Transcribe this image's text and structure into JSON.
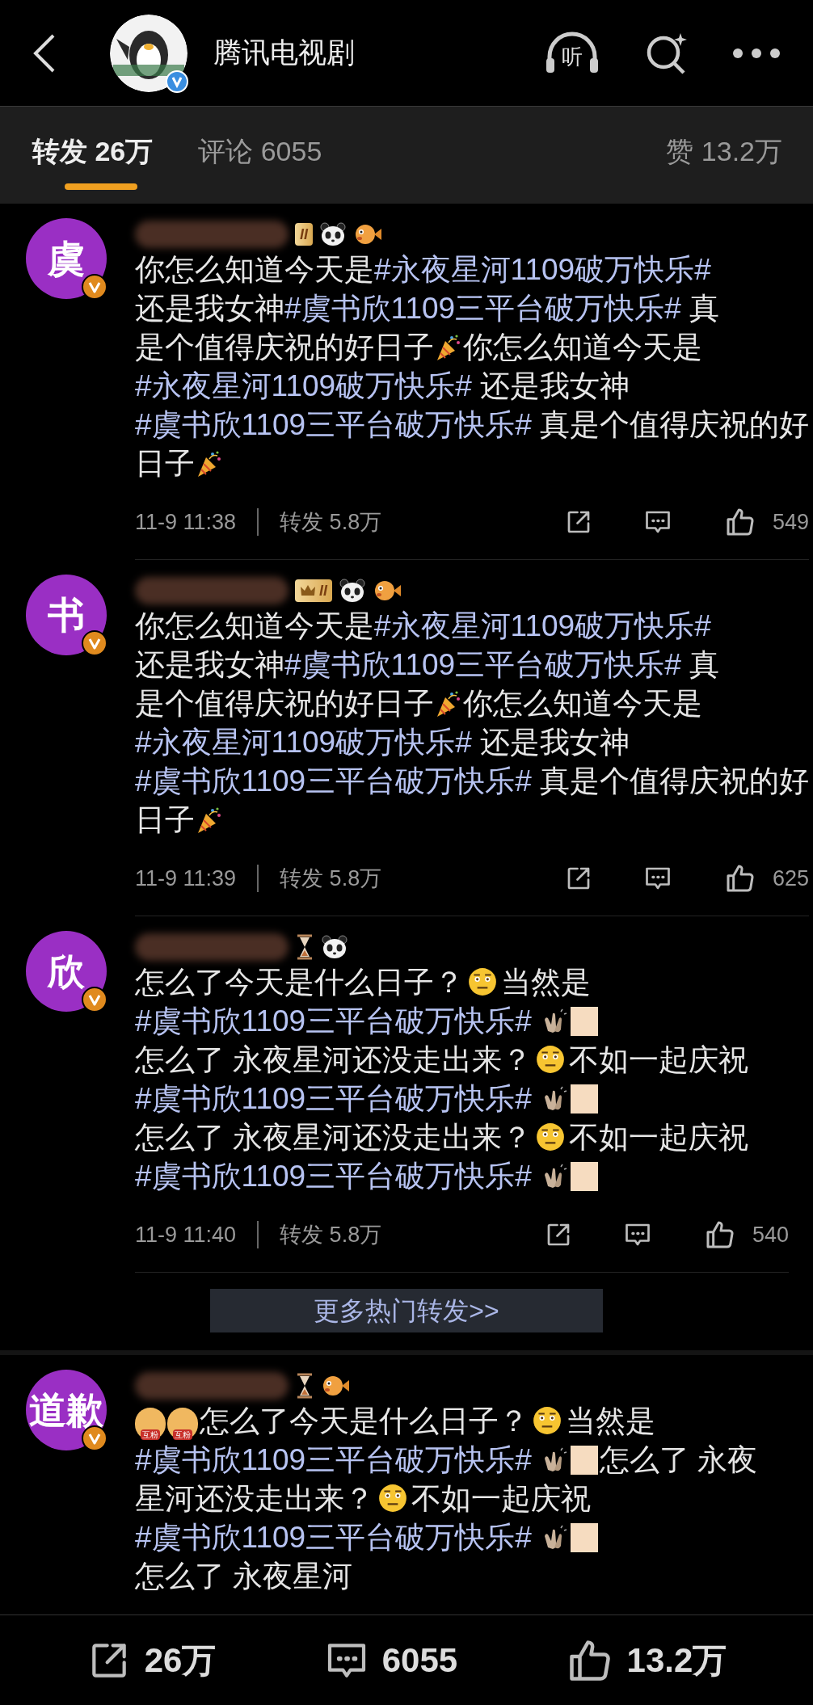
{
  "header": {
    "title": "腾讯电视剧",
    "listen_label": "听"
  },
  "tabs": [
    {
      "label": "转发 26万",
      "selected": true
    },
    {
      "label": "评论 6055",
      "selected": false
    },
    {
      "label": "赞 13.2万",
      "selected": false
    }
  ],
  "comments": [
    {
      "avatar": "虞",
      "badges": [
        {
          "kind": "level",
          "text": "II"
        },
        {
          "kind": "panda"
        },
        {
          "kind": "fish"
        }
      ],
      "segments": [
        {
          "kind": "text",
          "text": "你怎么知道今天是"
        },
        {
          "kind": "tag",
          "text": "#永夜星河1109破万快乐#"
        },
        {
          "kind": "text",
          "text": "还是我女神"
        },
        {
          "kind": "tag",
          "text": "#虞书欣1109三平台破万快乐#"
        },
        {
          "kind": "text",
          "text": " 真"
        },
        {
          "kind": "text",
          "text": "是个值得庆祝的好日子"
        },
        {
          "kind": "party"
        },
        {
          "kind": "text",
          "text": "你怎么知道今天是"
        },
        {
          "kind": "tag",
          "text": "#永夜星河1109破万快乐#"
        },
        {
          "kind": "text",
          "text": " 还是我女神"
        },
        {
          "kind": "tag",
          "text": "#虞书欣1109三平台破万快乐#"
        },
        {
          "kind": "text",
          "text": " 真是个值得庆祝的好"
        },
        {
          "kind": "text",
          "text": "日子"
        },
        {
          "kind": "party"
        }
      ],
      "time": "11-9 11:38",
      "reposts": "转发 5.8万",
      "likes": "549"
    },
    {
      "avatar": "书",
      "badges": [
        {
          "kind": "crown-level",
          "text": "II"
        },
        {
          "kind": "panda"
        },
        {
          "kind": "fish"
        }
      ],
      "segments": [
        {
          "kind": "text",
          "text": "你怎么知道今天是"
        },
        {
          "kind": "tag",
          "text": "#永夜星河1109破万快乐#"
        },
        {
          "kind": "text",
          "text": "还是我女神"
        },
        {
          "kind": "tag",
          "text": "#虞书欣1109三平台破万快乐#"
        },
        {
          "kind": "text",
          "text": " 真"
        },
        {
          "kind": "text",
          "text": "是个值得庆祝的好日子"
        },
        {
          "kind": "party"
        },
        {
          "kind": "text",
          "text": "你怎么知道今天是"
        },
        {
          "kind": "tag",
          "text": "#永夜星河1109破万快乐#"
        },
        {
          "kind": "text",
          "text": " 还是我女神"
        },
        {
          "kind": "tag",
          "text": "#虞书欣1109三平台破万快乐#"
        },
        {
          "kind": "text",
          "text": " 真是个值得庆祝的好"
        },
        {
          "kind": "text",
          "text": "日子"
        },
        {
          "kind": "party"
        }
      ],
      "time": "11-9 11:39",
      "reposts": "转发 5.8万",
      "likes": "625"
    },
    {
      "avatar": "欣",
      "badges": [
        {
          "kind": "hourglass"
        },
        {
          "kind": "panda"
        }
      ],
      "segments": [
        {
          "kind": "text",
          "text": "怎么了今天是什么日子？"
        },
        {
          "kind": "face"
        },
        {
          "kind": "text",
          "text": "当然是"
        },
        {
          "kind": "tag",
          "text": "#虞书欣1109三平台破万快乐#"
        },
        {
          "kind": "clap"
        },
        {
          "kind": "swatch"
        },
        {
          "kind": "text",
          "text": "怎么了 永夜星河"
        },
        {
          "kind": "text",
          "text": "还没走出来？"
        },
        {
          "kind": "face"
        },
        {
          "kind": "text",
          "text": "不如一起庆祝"
        },
        {
          "kind": "tag",
          "text": "#虞书欣1109三平台破万快乐#"
        },
        {
          "kind": "clap"
        },
        {
          "kind": "swatch"
        },
        {
          "kind": "text",
          "text": "怎么了 永夜星河还没"
        },
        {
          "kind": "text",
          "text": "走出来？"
        },
        {
          "kind": "face"
        },
        {
          "kind": "text",
          "text": "不如一起庆祝"
        },
        {
          "kind": "tag",
          "text": "#虞书欣1109三平台破万快乐#"
        },
        {
          "kind": "clap"
        },
        {
          "kind": "swatch"
        }
      ],
      "time": "11-9 11:40",
      "reposts": "转发 5.8万",
      "likes": "540"
    }
  ],
  "more_button": "更多热门转发>>",
  "last_comment": {
    "avatar": "道歉",
    "badges": [
      {
        "kind": "hourglass"
      },
      {
        "kind": "fish"
      }
    ],
    "segments": [
      {
        "kind": "fan",
        "text": "互粉"
      },
      {
        "kind": "fan",
        "text": "互粉"
      },
      {
        "kind": "text",
        "text": "怎么了今天是什么日子？"
      },
      {
        "kind": "face"
      },
      {
        "kind": "text",
        "text": "当然是"
      },
      {
        "kind": "tag",
        "text": "#虞书欣1109三平台破万快乐#"
      },
      {
        "kind": "clap"
      },
      {
        "kind": "swatch"
      },
      {
        "kind": "text",
        "text": "怎么了 永夜"
      },
      {
        "kind": "text",
        "text": "星河还没走出来？"
      },
      {
        "kind": "face"
      },
      {
        "kind": "text",
        "text": "不如一起庆祝"
      },
      {
        "kind": "tag",
        "text": "#虞书欣1109三平台破万快乐#"
      },
      {
        "kind": "clap"
      },
      {
        "kind": "swatch"
      },
      {
        "kind": "text",
        "text": "怎么了 永夜星河"
      }
    ]
  },
  "bottom_bar": {
    "reposts": "26万",
    "comments": "6055",
    "likes": "13.2万"
  }
}
